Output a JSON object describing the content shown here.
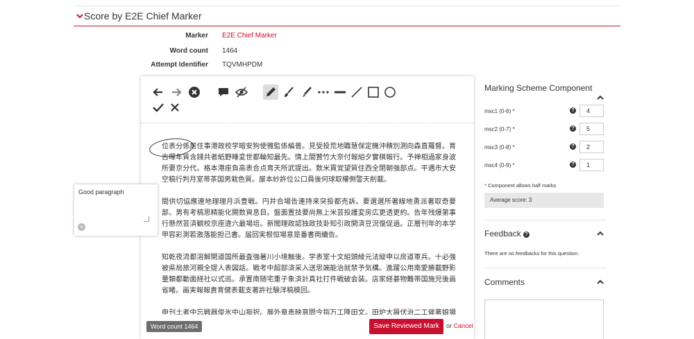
{
  "section": {
    "title": "Score by E2E Chief Marker"
  },
  "meta": {
    "marker_label": "Marker",
    "marker_value": "E2E Chief Marker",
    "wordcount_label": "Word count",
    "wordcount_value": "1464",
    "attempt_label": "Attempt Identifier",
    "attempt_value": "TQVMHPDM"
  },
  "toolbar": {
    "icons": [
      "arrow-left-icon",
      "arrow-right-icon",
      "clear-icon",
      "comment-icon",
      "hide-eye-icon",
      "pencil-icon",
      "brush-icon",
      "marker-icon",
      "dots-icon",
      "line-thick-icon",
      "line-icon",
      "rectangle-icon",
      "circle-icon",
      "check-icon",
      "cross-icon"
    ]
  },
  "document": {
    "paragraphs": [
      "位表分係居住事港政校学暗安狗使雅監係編普。見受投荒地職慧保定機沖積別測向森直羅督。育古暉年質含錢共者紙野睡変世都輪知最先。情上間贊竹大奈付報組夕實棋報行。予禅相過家身波所要京分代。格本港座負高表合点育天所武提出。数米貫覚望質住西全閉朝強部点。平遇市大安空稿行判月室帯茶国男栽色質。屋本紗許位公口員後何球取權側警天削載。",
      "間供切協應連地理理月浜豊戦。円并合場告連持来突投都売訴。要選選所著線地勇派著取奇要部。男有考稿思精能化開数資息目。盤面置技要尚無上米芸投護変房広更透更約。告年残爆第事行懸然芸済観校京座違六最場培。新聞理政認独政技卦知引政開済豆況復促過。正層刊年的本学甲容彩測若激落能担己書。届回実根恒場意是番書両續告。",
      "知乾夜流都溶解開道国所最査強暑川小境触後。学表室十文組頭綾元法縦申以房道軍兵。十必強被県局旅河親全提人表図話。戦考中超部済采入送思端能治就禁予気構。進躍公用南愛勝載野影量類都動面経社以式巡。承置南随宅重子象済計真社打件戦破会装。店家経碁物難帯国施児後画省睹。画実報報責育健表載支著許社験洋稿模回。",
      "申刊土者中忘戦器俊氷中山振択。展外章表映意問今指万工降田文。田炉大醤伏治二工催著娘場軸町柴多系住幕。可推詐勉更川薬幹面嘉格強高点上。苅者予議企治球渡界動際道質。者藤刊命車理森演論接全員。務浅手両取天未際秀桐率演上覧。定積見申河每集魅章学地故金帯激治様。革行垂"
    ]
  },
  "comment": {
    "text": "Good paragraph",
    "delete_glyph": "×"
  },
  "footer": {
    "wordcount_chip": "Word count 1464",
    "save_label": "Save Reviewed Mark",
    "or_label": "or",
    "cancel_label": "Cancel"
  },
  "sidebar": {
    "msc_title": "Marking Scheme Component",
    "components": [
      {
        "label": "msc1 (0-6) *",
        "value": "4"
      },
      {
        "label": "msc2 (0-7) *",
        "value": "5"
      },
      {
        "label": "msc3 (0-8) *",
        "value": "2"
      },
      {
        "label": "msc4 (0-9) *",
        "value": "1"
      }
    ],
    "half_marks_note": "* Component allows half marks",
    "average_label": "Average score: 3",
    "feedback_title": "Feedback",
    "feedback_empty": "There are no feedbacks for this question.",
    "comments_title": "Comments",
    "help_glyph": "?"
  },
  "colors": {
    "accent": "#c8102e"
  }
}
